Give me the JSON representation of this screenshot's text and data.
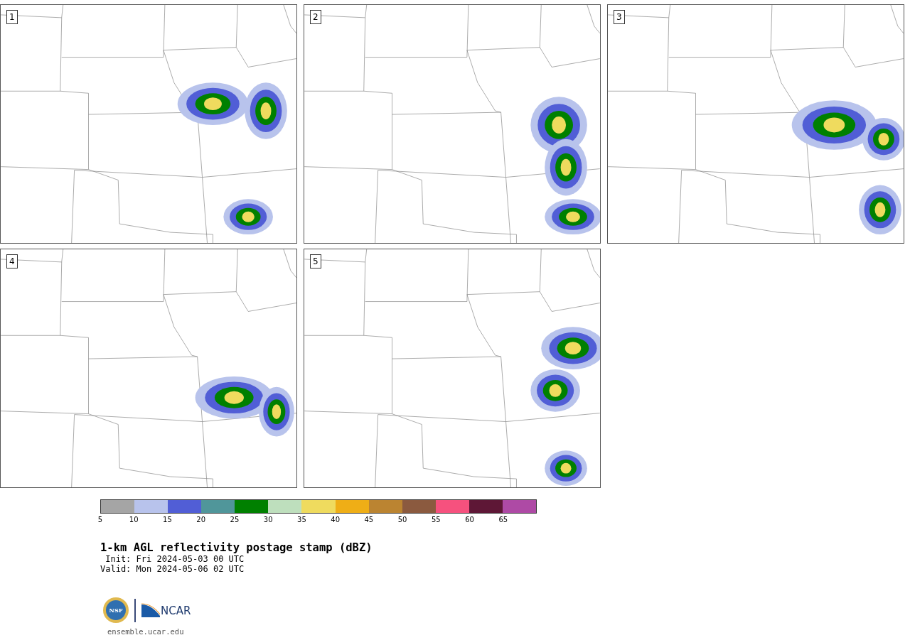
{
  "panels": [
    {
      "label": "1"
    },
    {
      "label": "2"
    },
    {
      "label": "3"
    },
    {
      "label": "4"
    },
    {
      "label": "5"
    }
  ],
  "colorbar": {
    "segments": [
      {
        "color": "#a5a5a5"
      },
      {
        "color": "#b8c3ec"
      },
      {
        "color": "#515ed6"
      },
      {
        "color": "#50969a"
      },
      {
        "color": "#008000"
      },
      {
        "color": "#bedfbd"
      },
      {
        "color": "#efdb5e"
      },
      {
        "color": "#efae16"
      },
      {
        "color": "#bb8431"
      },
      {
        "color": "#8b5a3f"
      },
      {
        "color": "#f6517e"
      },
      {
        "color": "#5e1736"
      },
      {
        "color": "#ae4aa5"
      }
    ],
    "ticks": [
      "5",
      "10",
      "15",
      "20",
      "25",
      "30",
      "35",
      "40",
      "45",
      "50",
      "55",
      "60",
      "65"
    ]
  },
  "title": "1-km AGL reflectivity postage stamp (dBZ)",
  "init": " Init: Fri 2024-05-03 00 UTC",
  "valid": "Valid: Mon 2024-05-06 02 UTC",
  "logos": {
    "nsf": "NSF",
    "ncar": "NCAR"
  },
  "footer": "ensemble.ucar.edu"
}
